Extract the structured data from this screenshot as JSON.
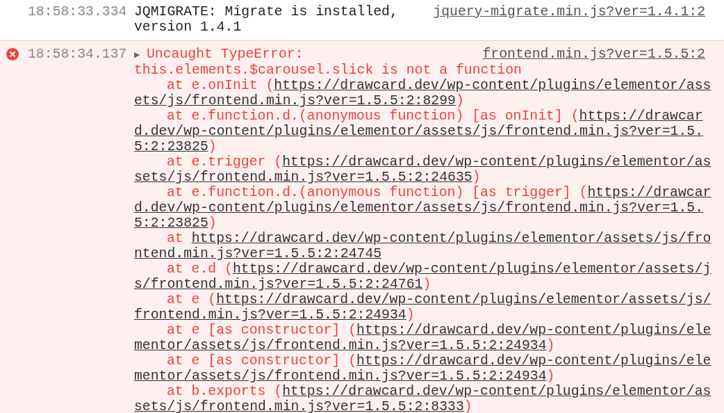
{
  "messages": [
    {
      "kind": "log",
      "timestamp": "18:58:33.334",
      "text": "JQMIGRATE: Migrate is installed, version 1.4.1",
      "source": "jquery-migrate.min.js?ver=1.4.1:2"
    },
    {
      "kind": "error",
      "timestamp": "18:58:34.137",
      "expander": "▶",
      "expanded": false,
      "text": "Uncaught TypeError:",
      "detail": "this.elements.$carousel.slick is not a function",
      "source": "frontend.min.js?ver=1.5.5:2",
      "stack": [
        {
          "text": "at e.onInit (",
          "url": "https://drawcard.dev/wp-content/plugins/elementor/assets/js/frontend.min.js?ver=1.5.5:2:8299",
          "tail": ")"
        },
        {
          "text": "at e.function.d.(anonymous function) [as onInit] (",
          "url": "https://drawcard.dev/wp-content/plugins/elementor/assets/js/frontend.min.js?ver=1.5.5:2:23825",
          "tail": ")"
        },
        {
          "text": "at e.trigger (",
          "url": "https://drawcard.dev/wp-content/plugins/elementor/assets/js/frontend.min.js?ver=1.5.5:2:24635",
          "tail": ")"
        },
        {
          "text": "at e.function.d.(anonymous function) [as trigger] (",
          "url": "https://drawcard.dev/wp-content/plugins/elementor/assets/js/frontend.min.js?ver=1.5.5:2:23825",
          "tail": ")"
        },
        {
          "text": "at ",
          "url": "https://drawcard.dev/wp-content/plugins/elementor/assets/js/frontend.min.js?ver=1.5.5:2:24745"
        },
        {
          "text": "at e.d (",
          "url": "https://drawcard.dev/wp-content/plugins/elementor/assets/js/frontend.min.js?ver=1.5.5:2:24761",
          "tail": ")"
        },
        {
          "text": "at e (",
          "url": "https://drawcard.dev/wp-content/plugins/elementor/assets/js/frontend.min.js?ver=1.5.5:2:24934",
          "tail": ")"
        },
        {
          "text": "at e [as constructor] (",
          "url": "https://drawcard.dev/wp-content/plugins/elementor/assets/js/frontend.min.js?ver=1.5.5:2:24934",
          "tail": ")"
        },
        {
          "text": "at e [as constructor] (",
          "url": "https://drawcard.dev/wp-content/plugins/elementor/assets/js/frontend.min.js?ver=1.5.5:2:24934",
          "tail": ")"
        },
        {
          "text": "at b.exports (",
          "url": "https://drawcard.dev/wp-content/plugins/elementor/assets/js/frontend.min.js?ver=1.5.5:2:8333",
          "tail": ")"
        }
      ]
    }
  ]
}
